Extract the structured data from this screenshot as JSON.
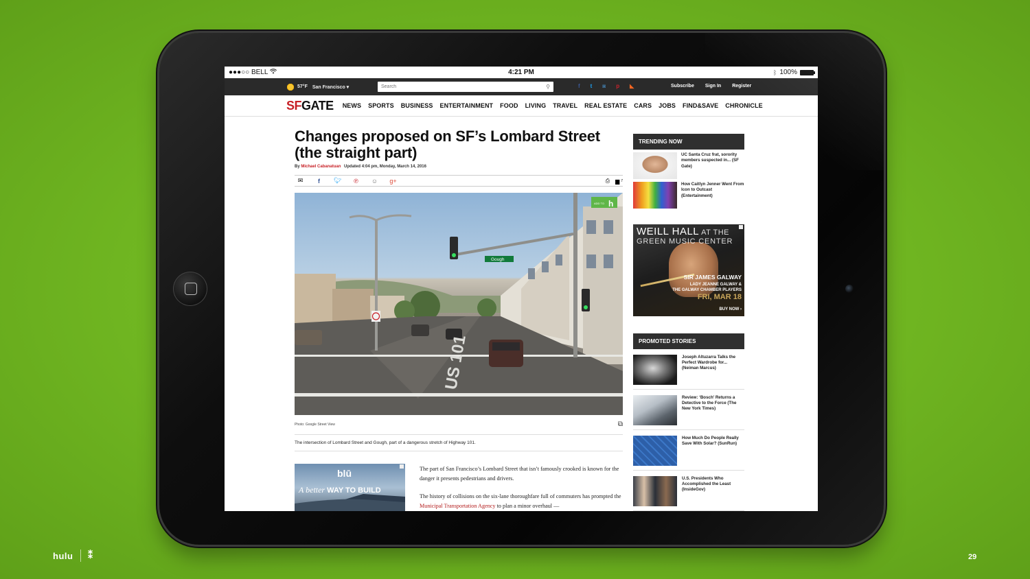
{
  "status_bar": {
    "carrier": "●●●○○ BELL",
    "wifi_icon": "wifi-icon",
    "time": "4:21 PM",
    "battery": "100%"
  },
  "topbar": {
    "temperature": "57°F",
    "city": "San Francisco ▾",
    "search_placeholder": "Search",
    "socials": [
      "f",
      "t",
      "◙",
      "p",
      "rss"
    ],
    "subscribe": "Subscribe",
    "sign_in": "Sign In",
    "register": "Register"
  },
  "nav": {
    "logo_sf": "SF",
    "logo_gate": "GATE",
    "items": [
      "NEWS",
      "SPORTS",
      "BUSINESS",
      "ENTERTAINMENT",
      "FOOD",
      "LIVING",
      "TRAVEL",
      "REAL ESTATE",
      "CARS",
      "JOBS",
      "FIND&SAVE",
      "CHRONICLE"
    ]
  },
  "article": {
    "headline": "Changes proposed on SF’s Lombard Street (the straight part)",
    "byline_prefix": "By",
    "author": "Michael Cabanatuan",
    "updated": "Updated 4:04 pm, Monday, March 14, 2016",
    "comment_count": "7",
    "photo_credit": "Photo: Google Street View",
    "caption": "The intersection of Lombard Street and Gough, part of a dangerous stretch of Highway 101.",
    "street_sign": "Gough",
    "road_marking": "US 101",
    "photo_badge": "h",
    "photo_badge_small": "ADD TO",
    "paragraph_1": "The part of San Francisco’s Lombard Street that isn’t famously crooked is known for the danger it presents pedestrians and drivers.",
    "paragraph_2_start": "The history of collisions on the six-lane thoroughfare full of commuters has prompted the ",
    "paragraph_2_link": "Municipal Transportation Agency",
    "paragraph_2_end": " to plan a minor overhaul —"
  },
  "ad_blu": {
    "brand": "blū",
    "tag_italic": "A better ",
    "tag_bold": "WAY TO BUILD"
  },
  "sidebar": {
    "trending_title": "TRENDING NOW",
    "trending": [
      {
        "text": "UC Santa Cruz frat, sorority members suspected in... (SF Gate)"
      },
      {
        "text": "How Caitlyn Jenner Went From Icon to Outcast (Entertainment)"
      }
    ],
    "weill_ad": {
      "title_big": "WEILL HALL",
      "title_small": " AT THE",
      "subtitle": "GREEN MUSIC CENTER",
      "star": "SIR JAMES GALWAY",
      "guests": "LADY JEANNE GALWAY &",
      "guests2": "THE GALWAY CHAMBER PLAYERS",
      "date": "FRI, MAR 18",
      "cta": "BUY NOW ›"
    },
    "promoted_title": "PROMOTED STORIES",
    "promoted": [
      {
        "text": "Joseph Altuzarra Talks the Perfect Wardrobe for... (Neiman Marcus)"
      },
      {
        "text": "Review: ‘Bosch’ Returns a Detective to the Force (The New York Times)"
      },
      {
        "text": "How Much Do People Really Save With Solar? (SunRun)"
      },
      {
        "text": "U.S. Presidents Who Accomplished the Least (InsideGov)"
      }
    ]
  },
  "slide": {
    "brand": "hulu",
    "mark": "⁑",
    "page_number": "29"
  },
  "colors": {
    "accent_red": "#c71f25",
    "background_green": "#6fb521",
    "dark_bar": "#2a2a2a"
  }
}
